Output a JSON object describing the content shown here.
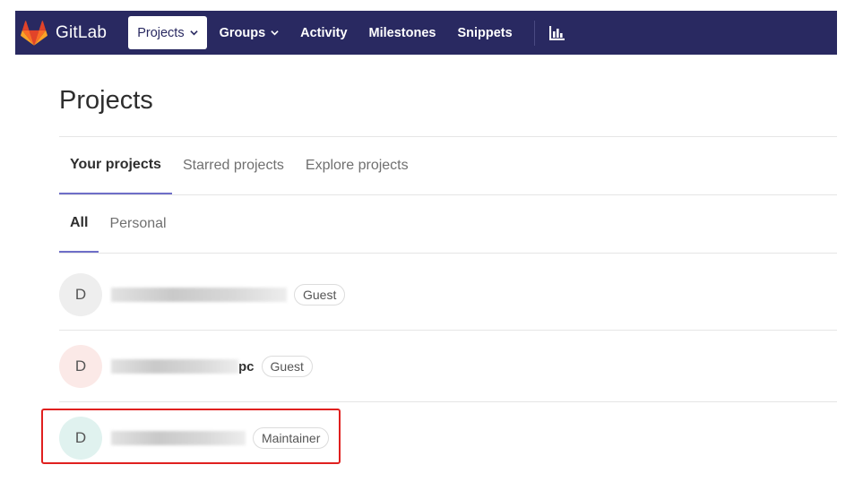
{
  "navbar": {
    "brand": "GitLab",
    "items": [
      {
        "label": "Projects",
        "active": true,
        "has_caret": true
      },
      {
        "label": "Groups",
        "active": false,
        "has_caret": true
      },
      {
        "label": "Activity",
        "active": false,
        "has_caret": false
      },
      {
        "label": "Milestones",
        "active": false,
        "has_caret": false
      },
      {
        "label": "Snippets",
        "active": false,
        "has_caret": false
      }
    ],
    "extra_icon": "chart-icon",
    "colors": {
      "background": "#292961",
      "logo": "#e2432a"
    }
  },
  "page": {
    "title": "Projects",
    "tabs": [
      "Your projects",
      "Starred projects",
      "Explore projects"
    ],
    "active_tab": "Your projects",
    "subtabs": [
      "All",
      "Personal"
    ],
    "active_subtab": "All",
    "accent_color": "#6e6ec8"
  },
  "projects": [
    {
      "avatar_letter": "D",
      "avatar_color": "#eeeeee",
      "name_suffix": "",
      "role": "Guest"
    },
    {
      "avatar_letter": "D",
      "avatar_color": "#fbe9e7",
      "name_suffix": "pc",
      "role": "Guest"
    },
    {
      "avatar_letter": "D",
      "avatar_color": "#e0f2ef",
      "name_suffix": "",
      "role": "Maintainer"
    }
  ],
  "annotation": {
    "highlight_color": "#e0201f"
  }
}
